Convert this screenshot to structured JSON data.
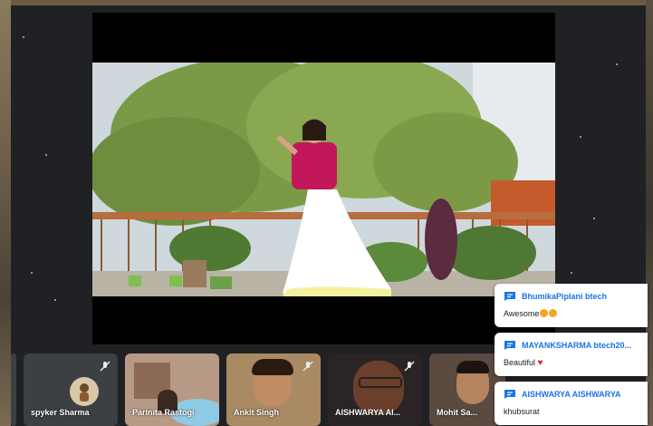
{
  "participants": [
    {
      "name": "",
      "kind": "edge"
    },
    {
      "name": "spyker Sharma",
      "kind": "avatar"
    },
    {
      "name": "Parinita Rastogi",
      "kind": "camera"
    },
    {
      "name": "Ankit Singh",
      "kind": "camera"
    },
    {
      "name": "AISHWARYA AI...",
      "kind": "camera"
    },
    {
      "name": "Mohit Sa...",
      "kind": "camera"
    }
  ],
  "chat_messages": [
    {
      "sender": "BhumikaPiplani btech",
      "text": "Awesome",
      "emoji": "star-struck-emoji x2"
    },
    {
      "sender": "MAYANKSHARMA btech20...",
      "text": "Beautiful",
      "emoji": "heart-emoji"
    },
    {
      "sender": "AISHWARYA AISHWARYA",
      "text": "khubsurat",
      "emoji": ""
    }
  ],
  "colors": {
    "background": "#202124",
    "tile": "#3c4043",
    "chat_sender": "#1a73e8",
    "heart": "#d93025"
  }
}
